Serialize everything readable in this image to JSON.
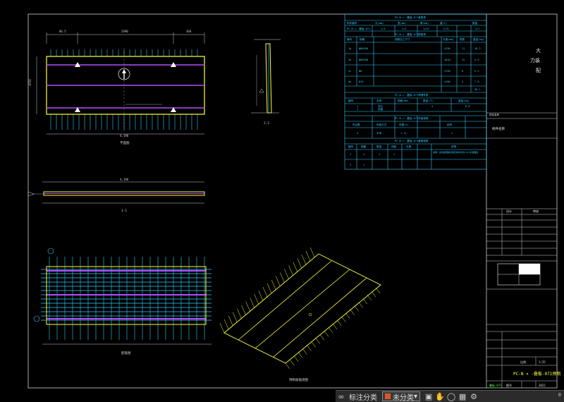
{
  "title_block": {
    "chars": [
      "大",
      "力装",
      "配"
    ],
    "project_note": "项目名称",
    "drawing_name_label": "构件名称",
    "sign_left": "设计",
    "sign_right": "审核",
    "row_labels": [
      "",
      "",
      "",
      "",
      "",
      ""
    ],
    "scale_label": "比例",
    "scale": "1:25",
    "sheet_label": "图号",
    "sheet_value": "2022",
    "drawing_title": "PC-N × -叠板-071预制",
    "code_green": "叠板-071"
  },
  "views": {
    "plan_label": "平面图",
    "section_label": "1-1",
    "side_label": "2-2",
    "rebar_label": "配筋图",
    "iso_label": "预制板轴测图",
    "top_dims": [
      "86.5",
      "2490",
      "360"
    ],
    "total_len": "4,190",
    "width": "1010",
    "sec_total": "4,190"
  },
  "tables": {
    "t1_title": "PC-N × -叠板-071参数表",
    "t1_headers": [
      "构件编号",
      "长(mm)",
      "宽(mm)",
      "厚(mm)",
      "重(t)",
      "数量"
    ],
    "t1_row": [
      "PC-N × -叠板-071",
      "1/4",
      "1/1",
      "1/23",
      "1/31",
      "1/1"
    ],
    "t2_title": "PC-N × -叠板-071配筋表",
    "t2_headers": [
      "编号",
      "规格",
      "钢筋加工尺寸",
      "长度(mm)",
      "根数",
      "重量(kg)"
    ],
    "t2_rows": [
      [
        "1a",
        "Φ8@200",
        "",
        "4190",
        "11",
        "18.2"
      ],
      [
        "2b",
        "Φ6@200",
        "",
        "1010",
        "22",
        "4.9"
      ],
      [
        "3c",
        "Φ8",
        "",
        "2190",
        "6",
        "5.2"
      ],
      [
        "4d",
        "Φ10",
        "",
        "4190",
        "3",
        "7.8"
      ]
    ],
    "t2_total": "36.1",
    "t3_title": "PC-N × -叠板-071预埋件表",
    "t3_headers": [
      "编号",
      "名称",
      "规格(mm)",
      "数量(个)",
      "重量(kg)"
    ],
    "t3_rows": [
      [
        "1",
        "吊钉",
        "",
        "4",
        "0.8"
      ],
      [
        "2",
        "线盒",
        "",
        "2",
        "0.6"
      ]
    ],
    "t4_title": "PC-N × -叠板-071吊装参数",
    "t4_headers": [
      "吊点数",
      "吊装方式",
      "吊重(t)",
      "",
      "起吊"
    ],
    "t4_row": [
      "4",
      "平吊",
      "1.11",
      "",
      "1"
    ],
    "t5_title": "PC-N × -叠板-071套筒参数",
    "t5_headers": [
      "编号",
      "规格",
      "数量",
      "间距",
      "长度",
      "说明"
    ],
    "t5_rows": [
      [
        "1",
        "1",
        "1",
        "1",
        "",
        "说明：叠合板钢筋桁架及构件详见(PC)标准图集"
      ],
      [
        "2",
        "1",
        "",
        "",
        "",
        ""
      ]
    ]
  },
  "statusbar": {
    "btn_group": "标注分类",
    "select_value": "未分类",
    "page_num": "0"
  },
  "colors": {
    "yellow": "#ffff3b",
    "cyan": "#33ccff",
    "magenta": "#b44cff",
    "white": "#e8e8e8",
    "green": "#3cff3c"
  }
}
